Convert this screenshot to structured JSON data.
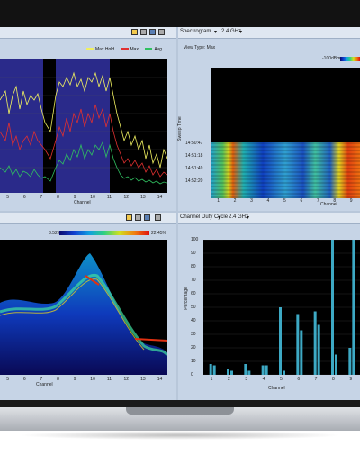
{
  "spectrum_panel": {
    "legend": {
      "max_hold": "Max Hold",
      "max": "Max",
      "avg": "Avg"
    },
    "xlabel": "Channel",
    "ticks": [
      "5",
      "6",
      "7",
      "8",
      "9",
      "10",
      "11",
      "12",
      "13",
      "14"
    ]
  },
  "spectrogram_panel": {
    "dropdown": "Spectrogram",
    "band": "2.4 GHz",
    "view_type": "View Type: Max",
    "colorbar_label": "-100dBm",
    "ylabel": "Sweep Time",
    "times": [
      "14:50:47",
      "14:51:18",
      "14:51:49",
      "14:52:20"
    ],
    "xlabel": "Channel",
    "ticks": [
      "1",
      "2",
      "3",
      "4",
      "5",
      "6",
      "7",
      "8",
      "9"
    ]
  },
  "density_panel": {
    "colorbar_min": "3.52%",
    "colorbar_max": "22.45%",
    "xlabel": "Channel",
    "ticks": [
      "5",
      "6",
      "7",
      "8",
      "9",
      "10",
      "11",
      "12",
      "13",
      "14"
    ]
  },
  "duty_panel": {
    "dropdown": "Channel Duty Cycle",
    "band": "2.4 GHz",
    "ylabel": "Percentage",
    "xlabel": "Channel",
    "yticks": [
      "100",
      "90",
      "80",
      "70",
      "60",
      "50",
      "40",
      "30",
      "20",
      "10",
      "0"
    ],
    "ticks": [
      "1",
      "2",
      "3",
      "4",
      "5",
      "6",
      "7",
      "8",
      "9"
    ]
  },
  "chart_data": [
    {
      "type": "line",
      "xlabel": "Channel",
      "series": [
        {
          "name": "Max Hold",
          "color": "#f0f060"
        },
        {
          "name": "Max",
          "color": "#e03030"
        },
        {
          "name": "Avg",
          "color": "#30c060"
        }
      ]
    },
    {
      "type": "bar",
      "xlabel": "Channel",
      "ylabel": "Percentage",
      "ylim": [
        0,
        100
      ],
      "categories": [
        "1",
        "2",
        "3",
        "4",
        "5",
        "6",
        "7",
        "8",
        "9"
      ],
      "series": [
        {
          "values": [
            8,
            4,
            8,
            7,
            50,
            45,
            47,
            100,
            20
          ],
          "color": "#3da9c4"
        },
        {
          "values": [
            7,
            3,
            3,
            7,
            3,
            33,
            37,
            15,
            100
          ],
          "color": "#3da9c4"
        }
      ]
    }
  ]
}
